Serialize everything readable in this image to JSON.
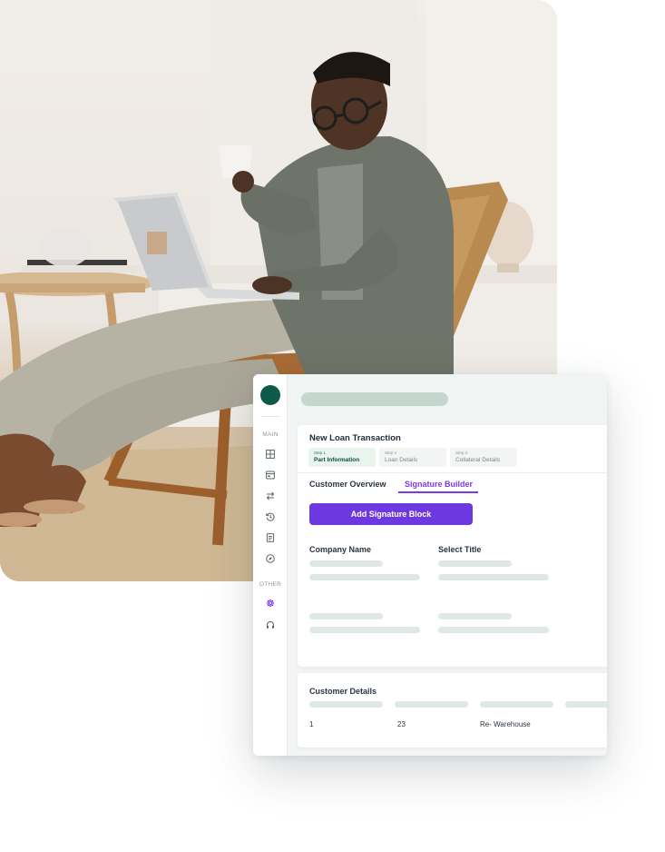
{
  "photo": {
    "subject": "man-with-laptop-photo"
  },
  "sidebar": {
    "sections": [
      {
        "label": "MAIN",
        "icons": [
          "grid-icon",
          "card-icon",
          "transfer-icon",
          "history-icon",
          "document-icon",
          "compass-icon"
        ]
      },
      {
        "label": "OTHER",
        "icons": [
          "gear-icon",
          "headset-icon"
        ]
      }
    ],
    "active_icon": "gear-icon",
    "accent": "#7c3aed",
    "brand": "#0d5a4a"
  },
  "panel": {
    "title": "New Loan Transaction",
    "steps": [
      {
        "num": "Step 1",
        "label": "Part Information",
        "active": true
      },
      {
        "num": "Step 2",
        "label": "Loan Details",
        "active": false
      },
      {
        "num": "Step 3",
        "label": "Collateral Details",
        "active": false
      }
    ],
    "tabs": [
      {
        "label": "Customer Overview",
        "active": false
      },
      {
        "label": "Signature Builder",
        "active": true
      }
    ],
    "cta_label": "Add Signature Block",
    "columns": [
      "Company Name",
      "Select Title"
    ]
  },
  "details": {
    "title": "Customer Details",
    "row": [
      "1",
      "23",
      "Re- Warehouse"
    ]
  }
}
